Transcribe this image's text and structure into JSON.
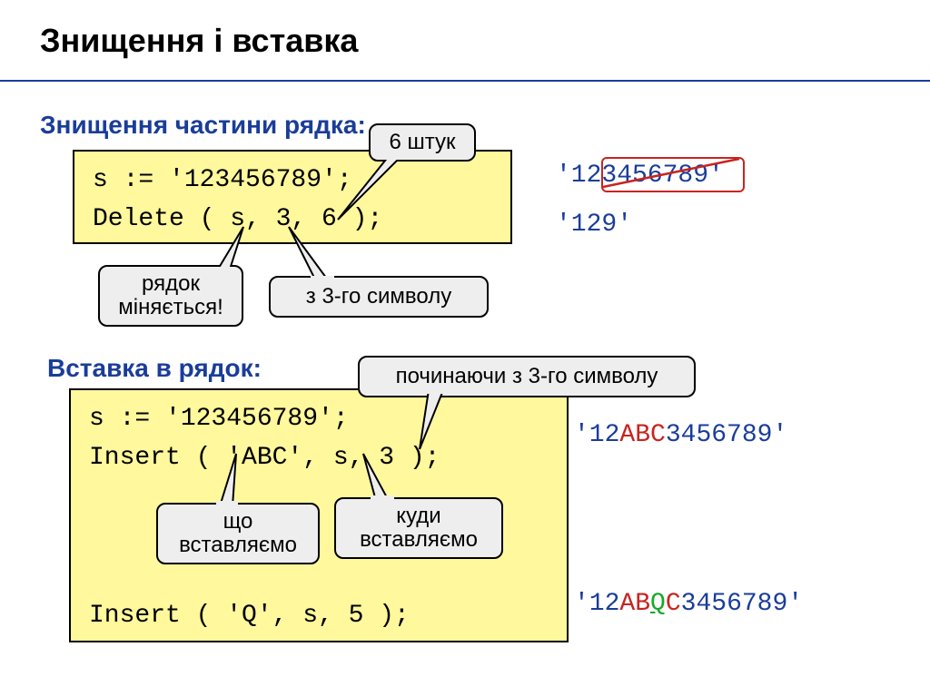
{
  "title": "Знищення і вставка",
  "section_delete": {
    "heading": "Знищення частини рядка:",
    "code": "s := '123456789';\nDelete ( s, 3, 6 );",
    "callout_count": "6 штук",
    "callout_changes": "рядок\nміняється!",
    "callout_from3": "з 3-го символу",
    "result_before": "'123456789'",
    "result_after": "'129'"
  },
  "section_insert": {
    "heading": "Вставка в рядок:",
    "code": "s := '123456789';\nInsert ( 'ABC', s, 3 );\n\n\n\nInsert ( 'Q', s, 5 );",
    "callout_start3": "починаючи з 3-го символу",
    "callout_what": "що\nвставляємо",
    "callout_where": "куди\nвставляємо",
    "result1_pre": "'12",
    "result1_mid": "ABC",
    "result1_post": "3456789'",
    "result2_pre": "'12",
    "result2_red1": "AB",
    "result2_green": "Q",
    "result2_red2": "C",
    "result2_post": "3456789'"
  }
}
